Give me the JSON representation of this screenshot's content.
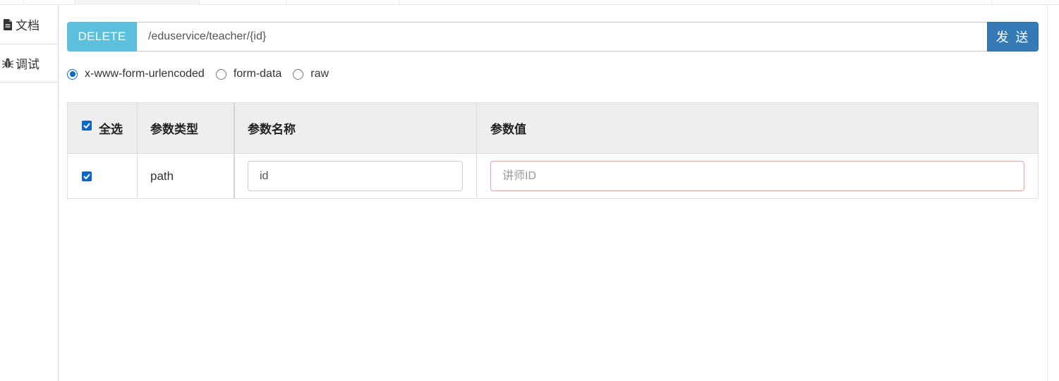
{
  "sidebar": {
    "tabs": [
      {
        "label": "文档",
        "icon": "file-icon"
      },
      {
        "label": "调试",
        "icon": "bug-icon"
      }
    ]
  },
  "request": {
    "method": "DELETE",
    "url": "/eduservice/teacher/{id}",
    "send_label": "发 送",
    "colors": {
      "method_badge": "#5bc0de",
      "send_button": "#337ab7"
    }
  },
  "body_types": {
    "options": [
      "x-www-form-urlencoded",
      "form-data",
      "raw"
    ],
    "selected": "x-www-form-urlencoded"
  },
  "params_table": {
    "headers": {
      "select_all": "全选",
      "param_type": "参数类型",
      "param_name": "参数名称",
      "param_value": "参数值"
    },
    "rows": [
      {
        "checked": true,
        "type": "path",
        "name": "id",
        "value": "",
        "value_placeholder": "讲师ID"
      }
    ]
  }
}
